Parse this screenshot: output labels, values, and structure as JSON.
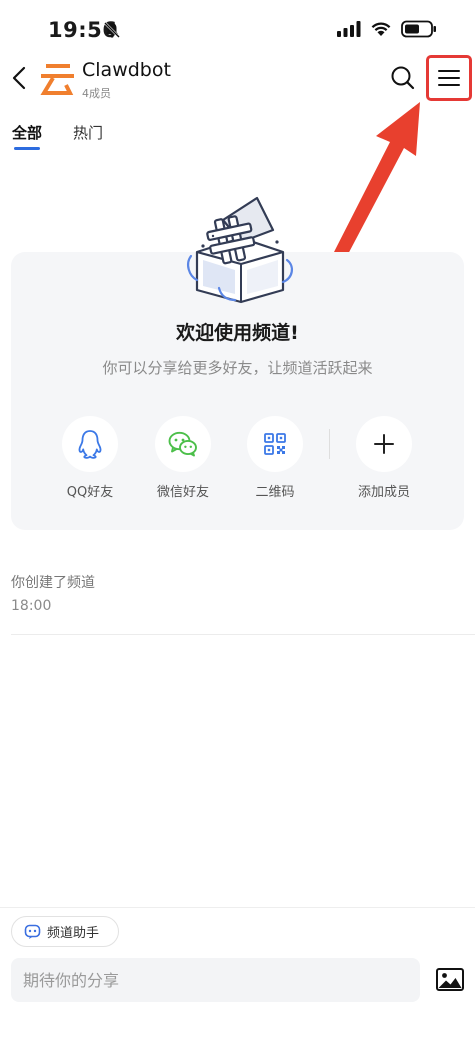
{
  "status_bar": {
    "time": "19:56",
    "icons": [
      "bell-off-icon",
      "cellular-signal-icon",
      "wifi-icon",
      "battery-icon"
    ]
  },
  "header": {
    "channel_name": "Clawdbot",
    "member_count": "4成员",
    "logo_glyph": "云",
    "icons": [
      "back-icon",
      "search-icon",
      "menu-icon"
    ]
  },
  "tabs": [
    {
      "label": "全部",
      "active": true
    },
    {
      "label": "热门",
      "active": false
    }
  ],
  "welcome": {
    "title": "欢迎使用频道!",
    "subtitle": "你可以分享给更多好友，让频道活跃起来",
    "share_options": [
      {
        "label": "QQ好友",
        "icon": "qq-penguin-icon"
      },
      {
        "label": "微信好友",
        "icon": "wechat-icon"
      },
      {
        "label": "二维码",
        "icon": "qr-code-icon"
      },
      {
        "label": "添加成员",
        "icon": "plus-icon"
      }
    ]
  },
  "feed": {
    "system_message": "你创建了频道",
    "system_time": "18:00"
  },
  "bottom": {
    "assistant_label": "频道助手",
    "input_placeholder": "期待你的分享"
  },
  "colors": {
    "accent_blue": "#2d6cdf",
    "logo_orange": "#f07f2e",
    "highlight_red": "#e53935",
    "wechat_green": "#4cbf4a",
    "card_bg": "#f5f6f8"
  }
}
